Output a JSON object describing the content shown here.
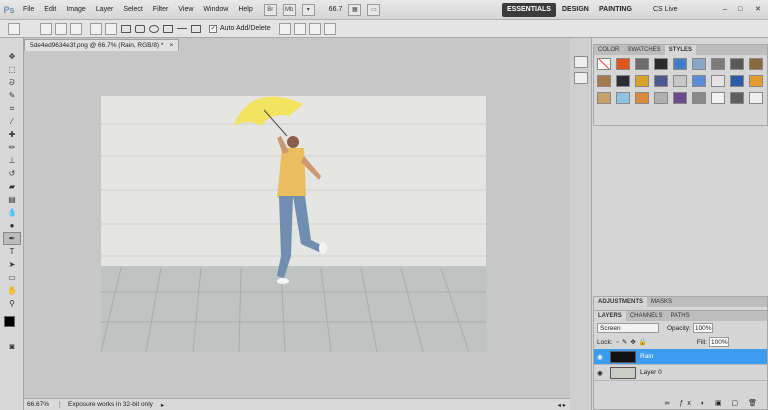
{
  "menubar": {
    "app_logo": "Ps",
    "items": [
      "File",
      "Edit",
      "Image",
      "Layer",
      "Select",
      "Filter",
      "View",
      "Window",
      "Help"
    ],
    "zoom": "66.7",
    "workspaces": [
      "ESSENTIALS",
      "DESIGN",
      "PAINTING"
    ],
    "cs_live": "CS Live"
  },
  "options": {
    "auto_add_delete": "Auto Add/Delete"
  },
  "document": {
    "tab_title": "5de4ed9634e3f.png @ 66.7% (Rain, RGB/8) *",
    "tab_close": "×",
    "status_zoom": "66.67%",
    "status_text": "Exposure works in 32-bit only"
  },
  "panels": {
    "color_tabs": [
      "COLOR",
      "SWATCHES",
      "STYLES"
    ],
    "adjust_tabs": [
      "ADJUSTMENTS",
      "MASKS"
    ],
    "layer_tabs": [
      "LAYERS",
      "CHANNELS",
      "PATHS"
    ],
    "blend_mode": "Screen",
    "opacity_label": "Opacity:",
    "opacity": "100%",
    "fill_label": "Fill:",
    "fill": "100%",
    "lock_label": "Lock:",
    "layers": [
      {
        "name": "Rain",
        "selected": true
      },
      {
        "name": "Layer 0",
        "selected": false
      }
    ]
  },
  "colors": {
    "accent": "#3c9cf0",
    "menubar": "#dcdcdc",
    "canvas_bg": "#c7c7c7"
  }
}
